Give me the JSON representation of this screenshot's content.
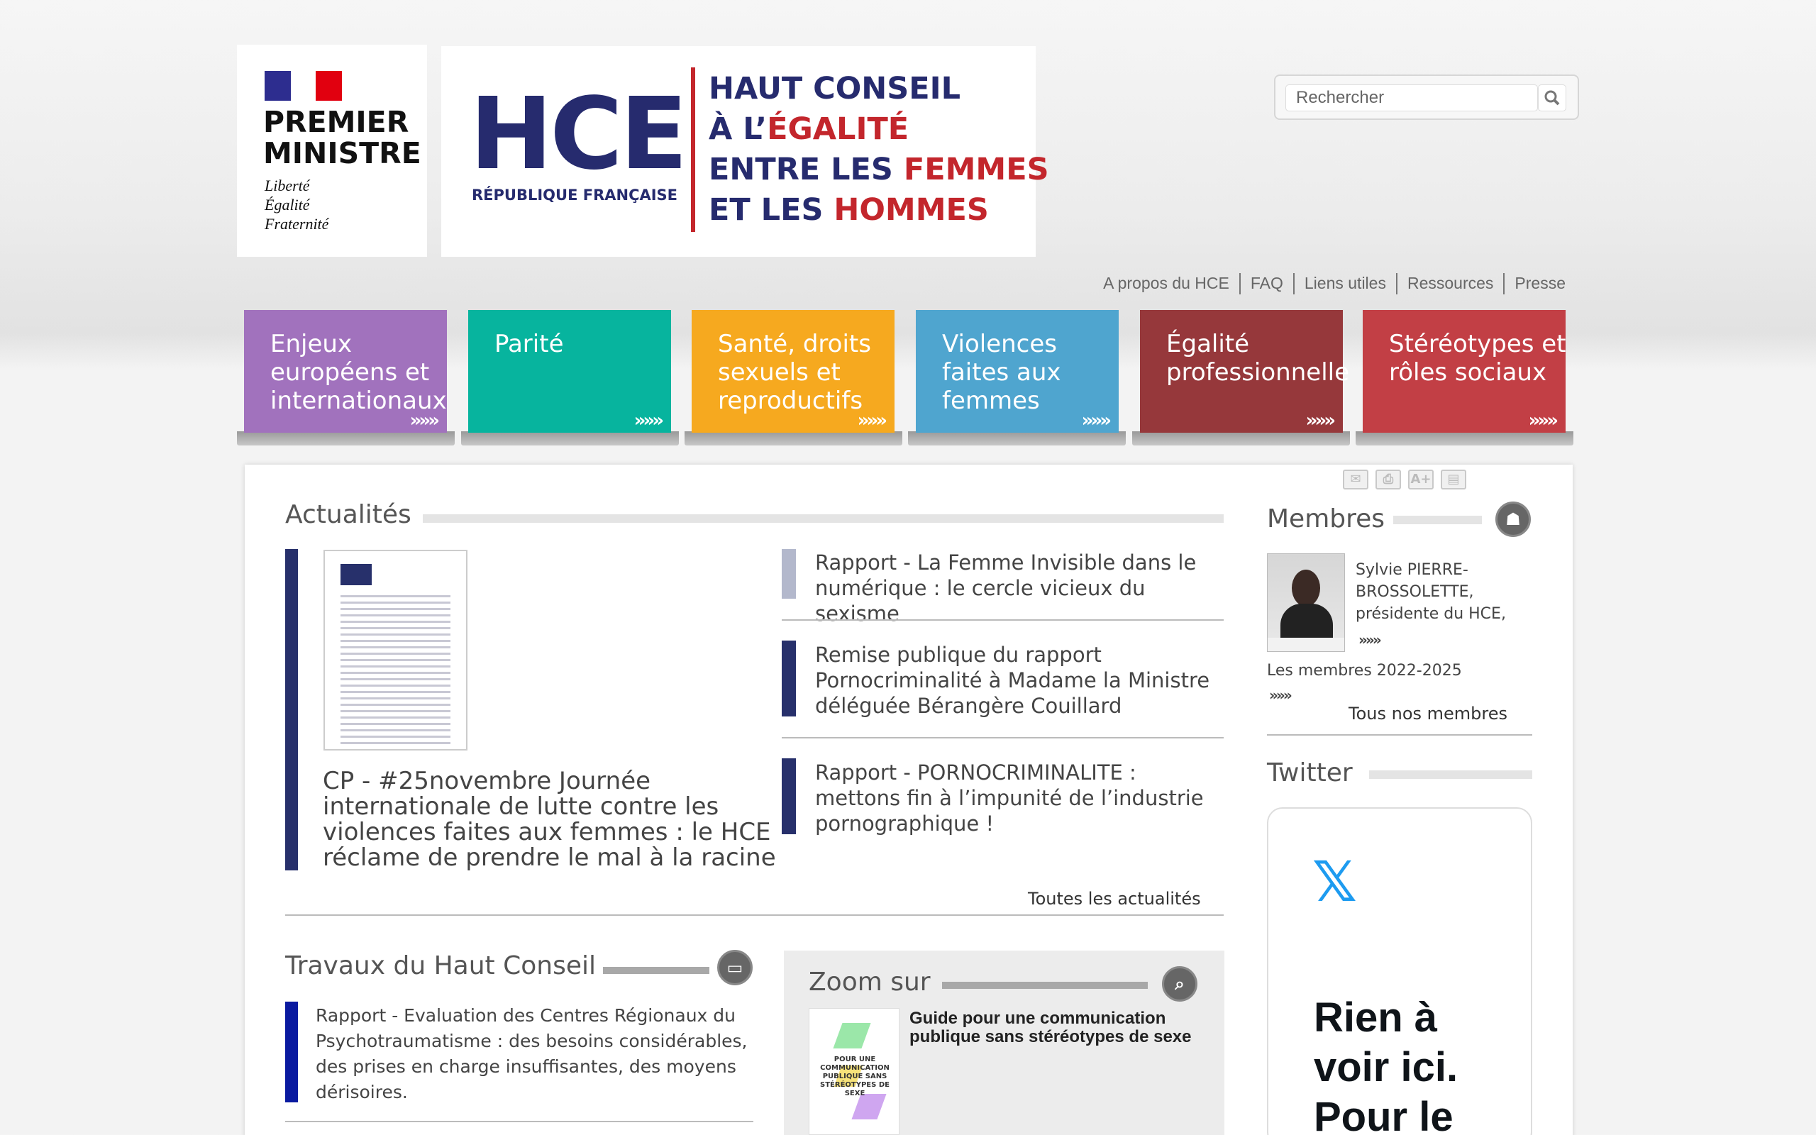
{
  "header": {
    "pm": {
      "title_line1": "PREMIER",
      "title_line2": "MINISTRE",
      "motto1": "Liberté",
      "motto2": "Égalité",
      "motto3": "Fraternité"
    },
    "hce": {
      "logo": "HCE",
      "republic": "RÉPUBLIQUE FRANÇAISE",
      "line1": "HAUT CONSEIL",
      "line2_a": "À L’",
      "line2_b": "ÉGALITÉ",
      "line3_a": "ENTRE LES ",
      "line3_b": "FEMMES",
      "line4_a": "ET LES ",
      "line4_b": "HOMMES"
    },
    "search_placeholder": "Rechercher"
  },
  "top_links": [
    "A propos du HCE",
    "FAQ",
    "Liens utiles",
    "Ressources",
    "Presse"
  ],
  "nav": [
    {
      "label": "Enjeux européens et internationaux",
      "color": "#a172bd"
    },
    {
      "label": "Parité",
      "color": "#07b49e"
    },
    {
      "label": "Santé, droits sexuels et reproductifs",
      "color": "#f6a91f"
    },
    {
      "label": "Violences faites aux femmes",
      "color": "#4fa5cf"
    },
    {
      "label": "Égalité professionnelle",
      "color": "#96383b"
    },
    {
      "label": "Stéréotypes et rôles sociaux",
      "color": "#c23f45"
    }
  ],
  "nav_arrows": "»»»",
  "actualites": {
    "title": "Actualités",
    "main_news": "CP - #25novembre Journée internationale de lutte contre les violences faites aux femmes : le HCE réclame de prendre le mal à la racine",
    "news": [
      "Rapport - La Femme Invisible dans le numérique : le cercle vicieux du sexisme",
      "Remise publique du rapport Pornocriminalité à Madame la Ministre déléguée Bérangère Couillard",
      "Rapport - PORNOCRIMINALITE : mettons fin à l’impunité de l’industrie pornographique !"
    ],
    "all_link": "Toutes les actualités"
  },
  "travaux": {
    "title": "Travaux du Haut Conseil",
    "item": "Rapport - Evaluation des Centres Régionaux du Psychotraumatisme : des besoins considérables, des prises en charge insuffisantes, des moyens dérisoires."
  },
  "zoom": {
    "title": "Zoom sur",
    "item": "Guide pour une communication publique sans stéréotypes de sexe",
    "thumb_text": "POUR UNE COMMUNICATION PUBLIQUE SANS STÉRÉOTYPES DE SEXE"
  },
  "membres": {
    "title": "Membres",
    "person": "Sylvie PIERRE-BROSSOLETTE, présidente du HCE,",
    "members_link": "Les membres 2022-2025",
    "all_members": "Tous nos membres",
    "arrows": "»»»"
  },
  "twitter": {
    "title": "Twitter",
    "logo": "𝕏",
    "text": "Rien à voir ici. Pour le"
  },
  "tools": [
    "✉",
    "⎙",
    "A+",
    "▤"
  ]
}
